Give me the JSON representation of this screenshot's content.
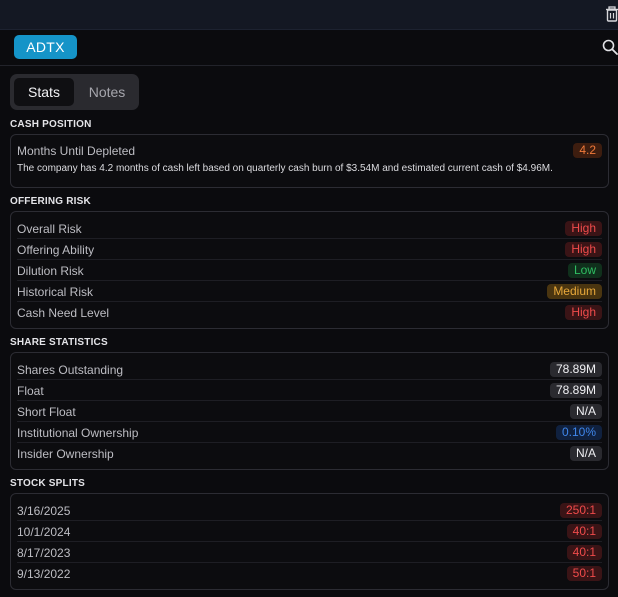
{
  "header": {
    "ticker": "ADTX"
  },
  "tabs": [
    {
      "label": "Stats"
    },
    {
      "label": "Notes"
    }
  ],
  "cash_position": {
    "title": "CASH POSITION",
    "label": "Months Until Depleted",
    "value": "4.2",
    "description": "The company has 4.2 months of cash left based on quarterly cash burn of $3.54M and estimated current cash of $4.96M."
  },
  "offering_risk": {
    "title": "OFFERING RISK",
    "rows": [
      {
        "label": "Overall Risk",
        "value": "High"
      },
      {
        "label": "Offering Ability",
        "value": "High"
      },
      {
        "label": "Dilution Risk",
        "value": "Low"
      },
      {
        "label": "Historical Risk",
        "value": "Medium"
      },
      {
        "label": "Cash Need Level",
        "value": "High"
      }
    ]
  },
  "share_statistics": {
    "title": "SHARE STATISTICS",
    "rows": [
      {
        "label": "Shares Outstanding",
        "value": "78.89M"
      },
      {
        "label": "Float",
        "value": "78.89M"
      },
      {
        "label": "Short Float",
        "value": "N/A"
      },
      {
        "label": "Institutional Ownership",
        "value": "0.10%"
      },
      {
        "label": "Insider Ownership",
        "value": "N/A"
      }
    ]
  },
  "stock_splits": {
    "title": "STOCK SPLITS",
    "rows": [
      {
        "label": "3/16/2025",
        "value": "250:1"
      },
      {
        "label": "10/1/2024",
        "value": "40:1"
      },
      {
        "label": "8/17/2023",
        "value": "40:1"
      },
      {
        "label": "9/13/2022",
        "value": "50:1"
      }
    ]
  },
  "colors": {
    "ticker_bg": "#1594c8",
    "high": "#ef4b4b",
    "low": "#2fbf62",
    "medium": "#e8a83a",
    "months_badge": "#f07a3a",
    "ownership": "#3f86ea"
  },
  "icons": {
    "top_right": "trash-icon",
    "search": "search-icon"
  }
}
